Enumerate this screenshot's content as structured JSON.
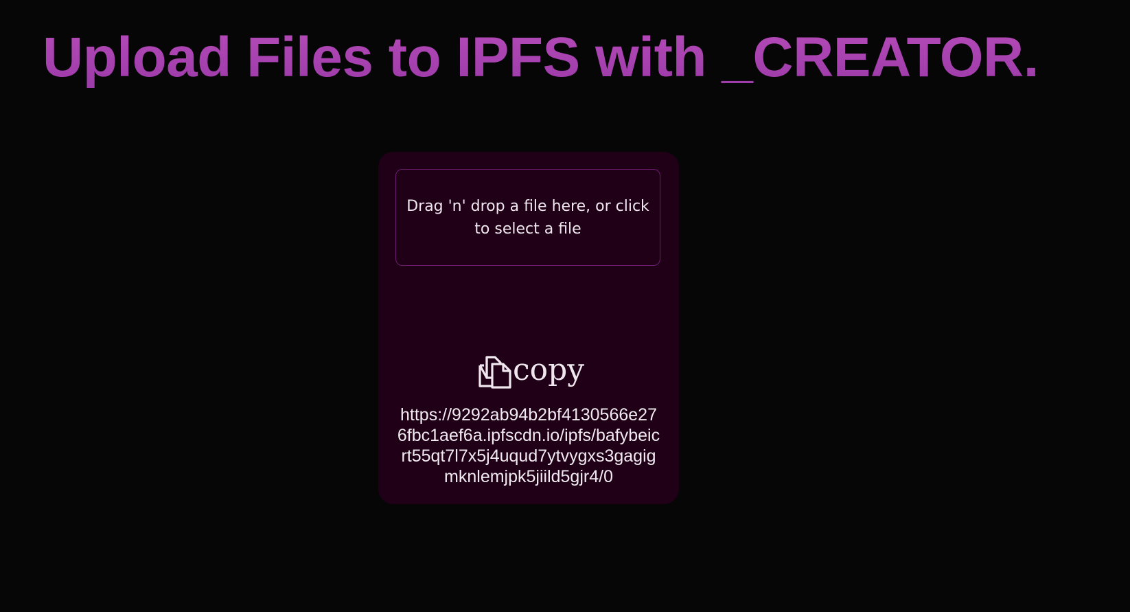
{
  "header": {
    "title": "Upload Files to IPFS with _CREATOR."
  },
  "uploader": {
    "dropzone_text": "Drag 'n' drop a file here, or click to select a file",
    "copy_label": "copy",
    "copy_icon": "copy-icon",
    "uploaded_url": "https://9292ab94b2bf4130566e276fbc1aef6a.ipfscdn.io/ipfs/bafybeicrt55qt7l7x5j4uqud7ytvygxs3gagigmknlemjpk5jiild5gjr4/0"
  },
  "colors": {
    "background": "#060606",
    "card": "#1f0017",
    "dropzone_border": "#6e1c70",
    "title_gradient_start": "#b64bb8",
    "title_gradient_end": "#9a3aa8",
    "text": "#efe6ee"
  }
}
